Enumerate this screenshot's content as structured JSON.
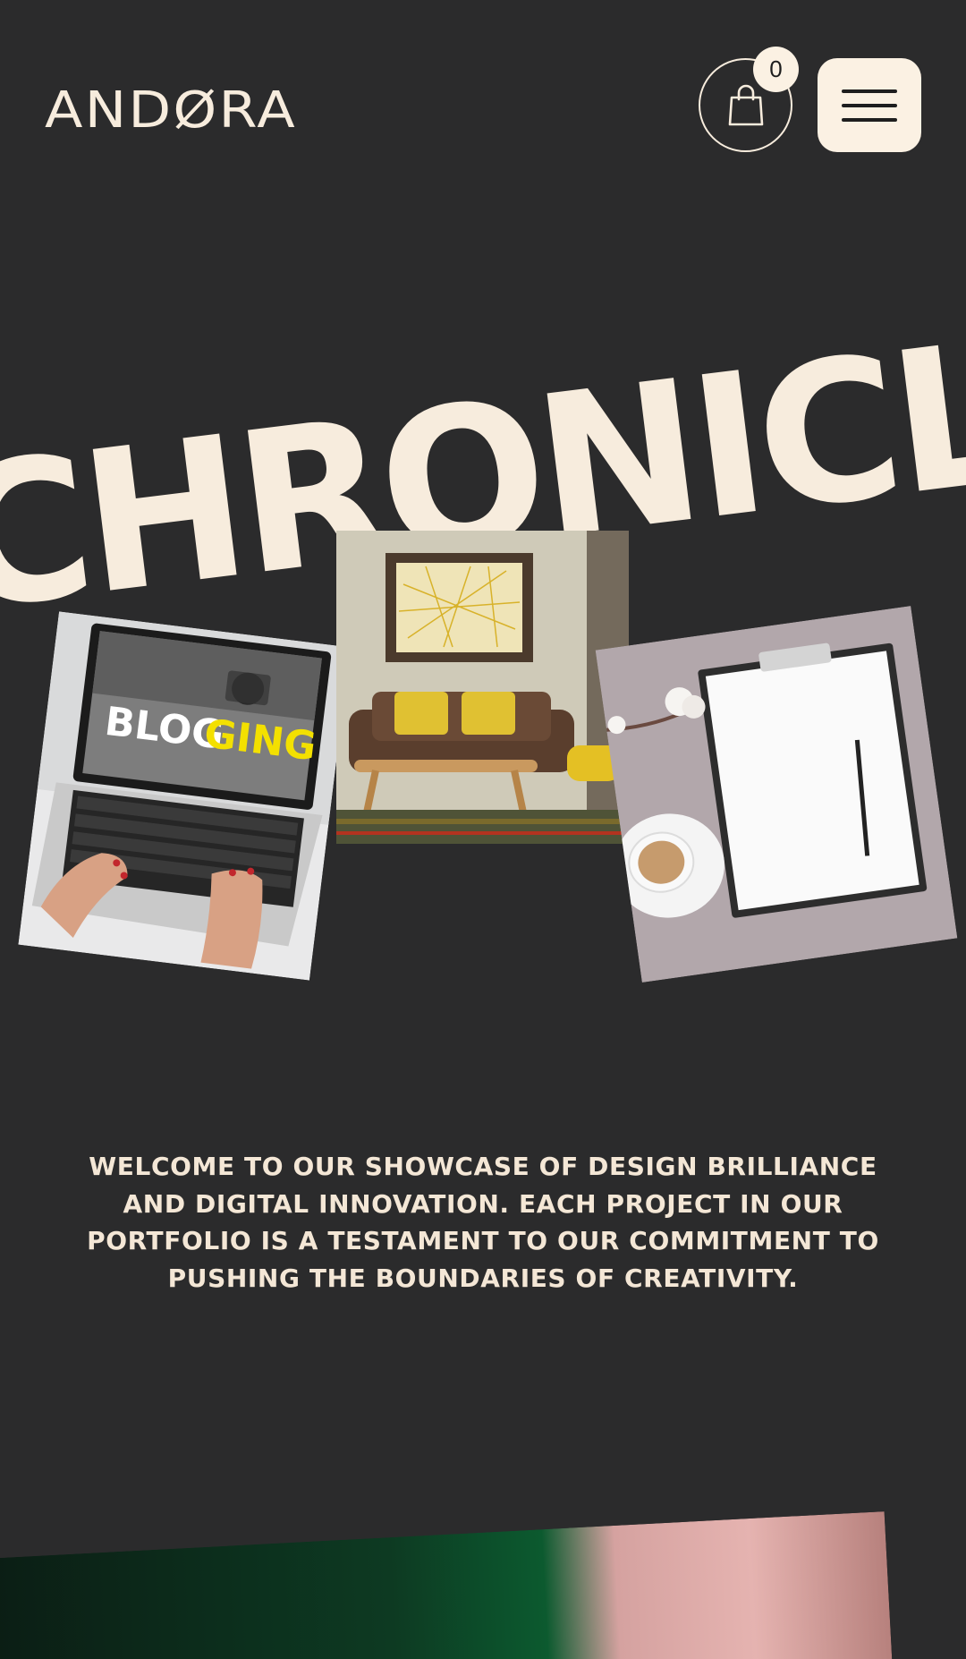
{
  "header": {
    "logo_text": "ANDØRA",
    "cart_count": "0",
    "cart_icon": "shopping-bag-icon",
    "menu_icon": "hamburger-menu-icon"
  },
  "hero": {
    "title": "CHRONICLE",
    "cards": [
      {
        "name": "blogging-laptop",
        "screen_text_1": "BLOG",
        "screen_text_2": "GING"
      },
      {
        "name": "living-room-sofa"
      },
      {
        "name": "clipboard-coffee"
      }
    ]
  },
  "intro": {
    "text": "WELCOME TO OUR SHOWCASE OF DESIGN BRILLIANCE AND DIGITAL INNOVATION. EACH PROJECT IN OUR PORTFOLIO IS A TESTAMENT TO OUR COMMITMENT TO PUSHING THE BOUNDARIES OF CREATIVITY."
  },
  "colors": {
    "background": "#2b2b2c",
    "cream": "#f7ecdd",
    "dark": "#1e1e1e",
    "accent_yellow": "#f3e000"
  }
}
